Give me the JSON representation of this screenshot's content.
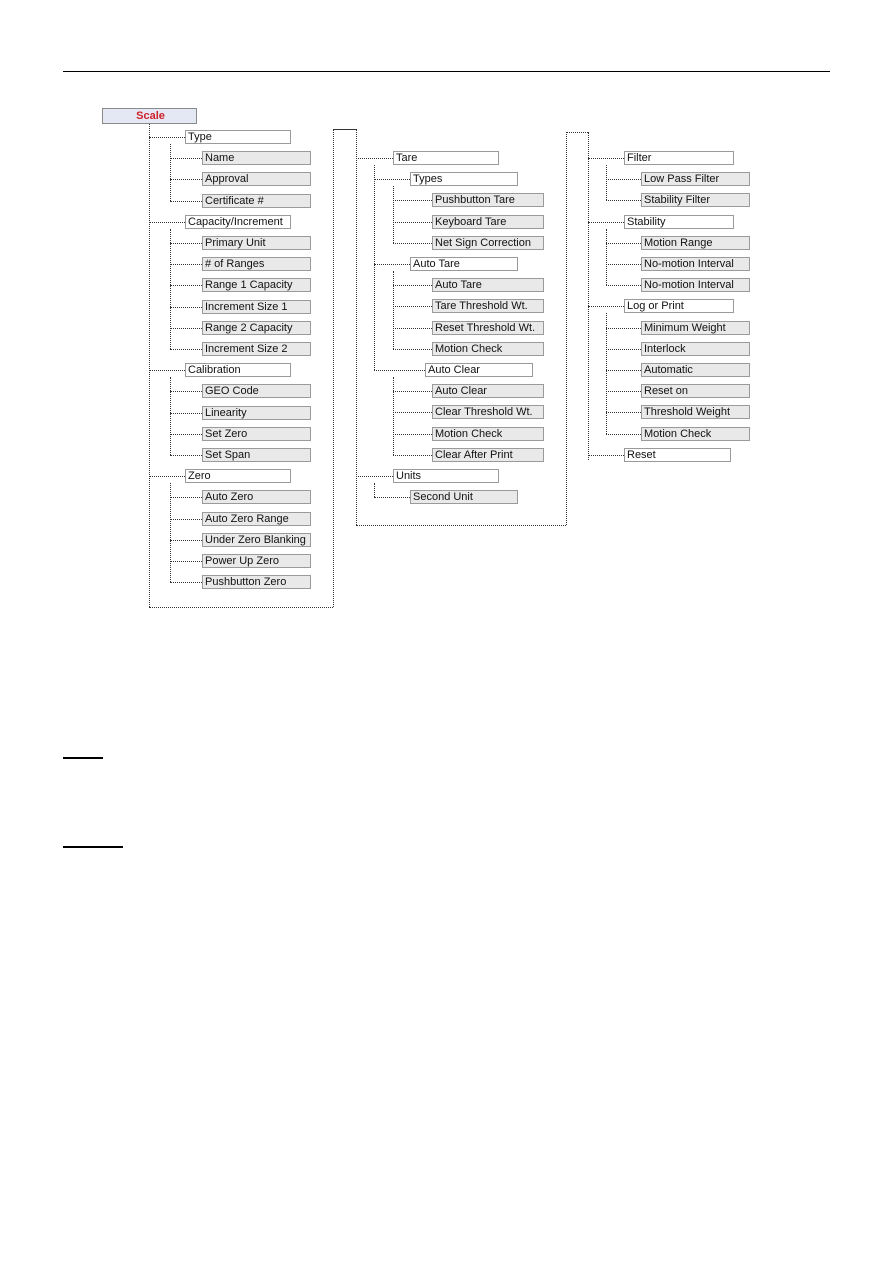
{
  "root": {
    "label": "Scale"
  },
  "columns": [
    {
      "groups": [
        {
          "label": "Type",
          "children": [
            "Name",
            "Approval",
            "Certificate #"
          ]
        },
        {
          "label": "Capacity/Increment",
          "children": [
            "Primary Unit",
            "# of Ranges",
            "Range 1 Capacity",
            "Increment Size 1",
            "Range 2 Capacity",
            "Increment Size 2"
          ]
        },
        {
          "label": "Calibration",
          "children": [
            "GEO Code",
            "Linearity",
            "Set Zero",
            "Set Span"
          ]
        },
        {
          "label": "Zero",
          "children": [
            "Auto Zero",
            "Auto Zero Range",
            "Under Zero Blanking",
            "Power Up Zero",
            "Pushbutton Zero"
          ]
        }
      ]
    },
    {
      "groups": [
        {
          "label": "Tare",
          "subgroups": [
            {
              "label": "Types",
              "children": [
                "Pushbutton Tare",
                "Keyboard Tare",
                "Net Sign Correction"
              ]
            },
            {
              "label": "Auto Tare",
              "children": [
                "Auto Tare",
                "Tare Threshold Wt.",
                "Reset Threshold Wt.",
                "Motion Check"
              ]
            },
            {
              "label": "Auto Clear",
              "children": [
                "Auto Clear",
                "Clear Threshold Wt.",
                "Motion Check",
                "Clear After Print"
              ]
            }
          ]
        },
        {
          "label": "Units",
          "children": [
            "Second Unit"
          ]
        }
      ]
    },
    {
      "groups": [
        {
          "label": "Filter",
          "children": [
            "Low Pass Filter",
            "Stability Filter"
          ]
        },
        {
          "label": "Stability",
          "children": [
            "Motion Range",
            "No-motion Interval",
            "No-motion Interval"
          ]
        },
        {
          "label": "Log or Print",
          "children": [
            "Minimum Weight",
            "Interlock",
            "Automatic",
            "Reset on",
            "Threshold Weight",
            "Motion Check"
          ]
        },
        {
          "label": "Reset",
          "children": []
        }
      ]
    }
  ],
  "colors": {
    "root_text": "#d0202a",
    "root_bg": "#e4e8f4",
    "child_bg": "#e9e9e9"
  }
}
